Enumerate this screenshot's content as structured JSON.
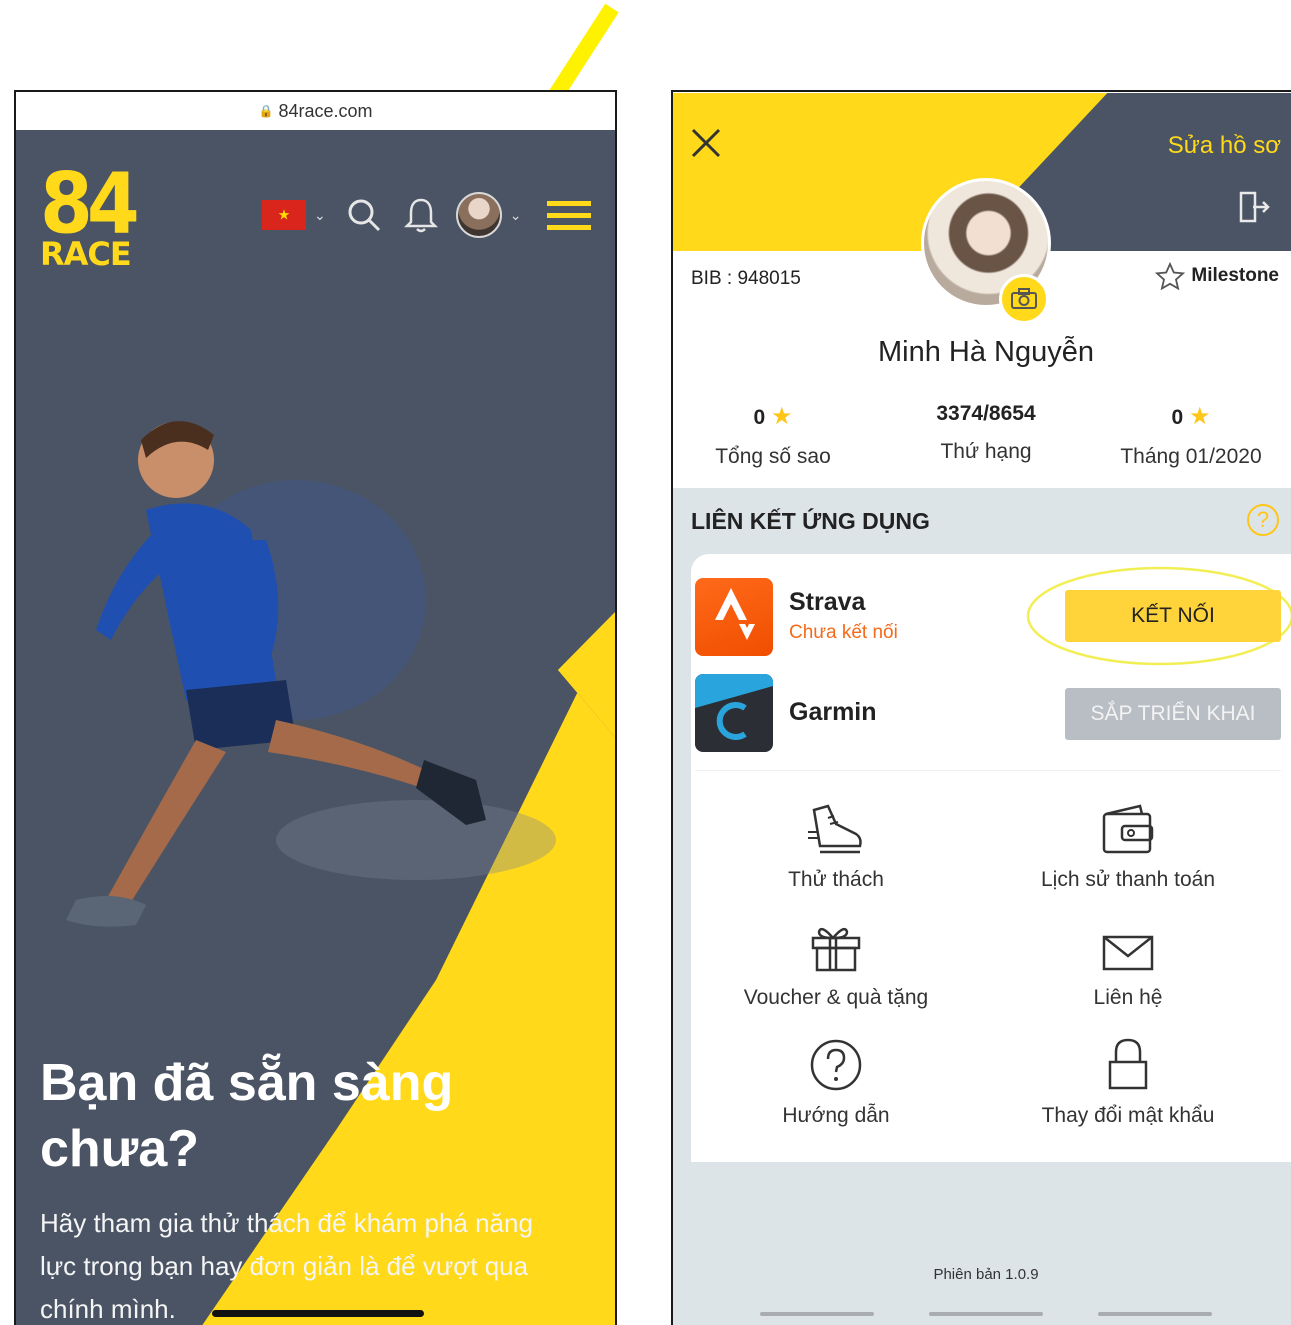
{
  "left_phone": {
    "url": "84race.com",
    "logo_number": "84",
    "logo_word": "RACE",
    "headline_line1": "Bạn đã sẵn sàng",
    "headline_line2": "chưa?",
    "subline_line1": "Hãy tham gia thử thách để khám phá năng",
    "subline_line2": "lực trong bạn hay đơn giản là để vượt qua",
    "subline_line3": "chính mình.",
    "icons": [
      "vietnam-flag-icon",
      "chevron-down-icon",
      "search-icon",
      "bell-icon",
      "avatar",
      "menu-icon"
    ]
  },
  "right_phone": {
    "edit_profile": "Sửa hồ sơ",
    "bib": "BIB : 948015",
    "milestone": "Milestone",
    "name": "Minh Hà Nguyễn",
    "stats": [
      {
        "value": "0",
        "label": "Tổng số sao"
      },
      {
        "value": "3374/8654",
        "label": "Thứ hạng"
      },
      {
        "value": "0",
        "label": "Tháng 01/2020"
      }
    ],
    "link_section_title": "LIÊN KẾT ỨNG DỤNG",
    "help_symbol": "?",
    "apps": [
      {
        "name": "Strava",
        "status": "Chưa kết nối",
        "button": "KẾT NỐI"
      },
      {
        "name": "Garmin",
        "status": "",
        "button": "SẮP TRIỂN KHAI"
      }
    ],
    "menu": [
      {
        "label": "Thử thách",
        "icon": "shoe-icon"
      },
      {
        "label": "Lịch sử thanh toán",
        "icon": "wallet-icon"
      },
      {
        "label": "Voucher & quà tặng",
        "icon": "gift-icon"
      },
      {
        "label": "Liên hệ",
        "icon": "mail-icon"
      },
      {
        "label": "Hướng dẫn",
        "icon": "question-icon"
      },
      {
        "label": "Thay đổi mật khẩu",
        "icon": "lock-icon"
      }
    ],
    "version": "Phiên bản 1.0.9"
  },
  "colors": {
    "brand_yellow": "#ffd91a",
    "hero_bg": "#4a5464",
    "strava_orange": "#f04e00",
    "disabled_grey": "#b9bec4",
    "section_grey": "#dde4e8"
  }
}
